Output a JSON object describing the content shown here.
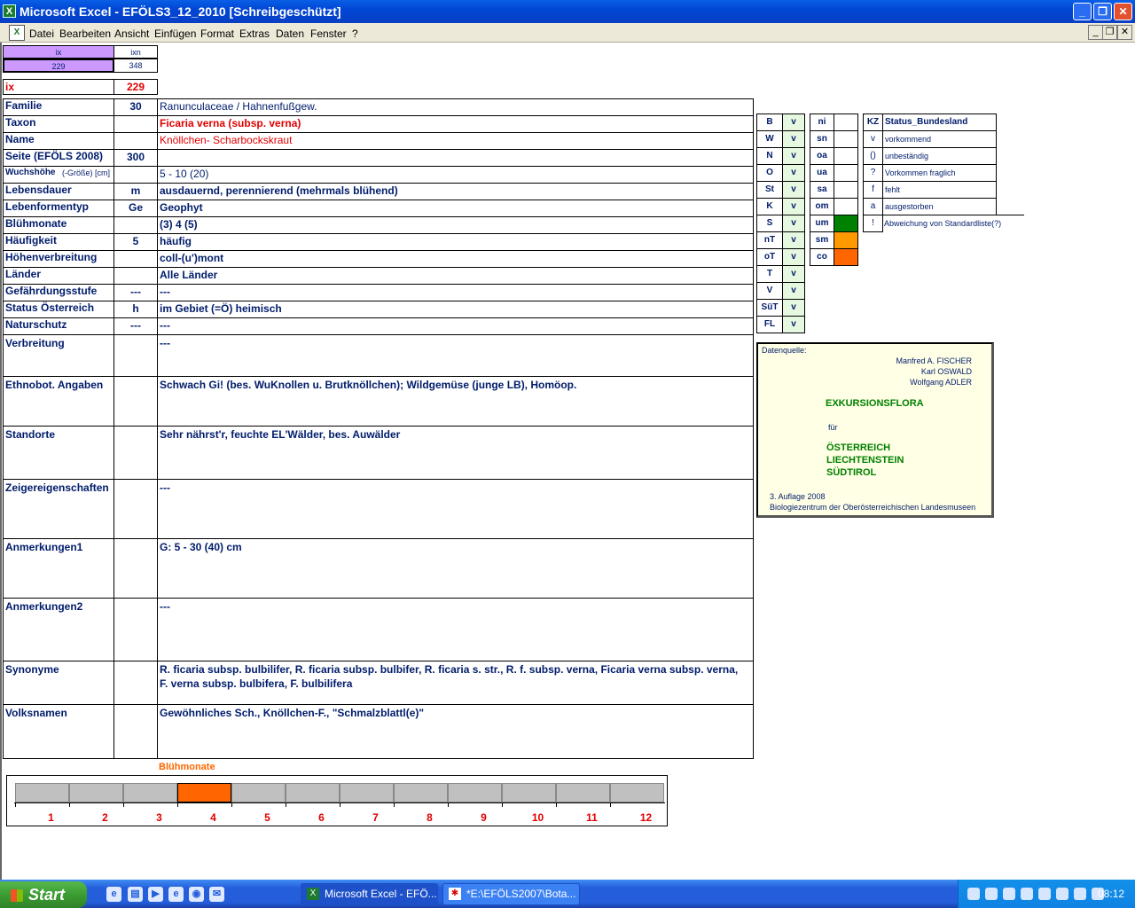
{
  "window": {
    "title": "Microsoft Excel - EFÖLS3_12_2010  [Schreibgeschützt]"
  },
  "menu": [
    "Datei",
    "Bearbeiten",
    "Ansicht",
    "Einfügen",
    "Format",
    "Extras",
    "Daten",
    "Fenster",
    "?"
  ],
  "top_cells": {
    "ix_label": "ix",
    "ixn_label": "ixn",
    "ix_value": "229",
    "ixn_value": "348",
    "ix_row_label": "ix",
    "ix_row_value": "229"
  },
  "fields": [
    {
      "label": "Familie",
      "mid": "30",
      "value": "Ranunculaceae  /  Hahnenfußgew."
    },
    {
      "label": "Taxon",
      "mid": "",
      "value": "Ficaria verna (subsp. verna)"
    },
    {
      "label": "Name",
      "mid": "",
      "value": "Knöllchen- Scharbockskraut"
    },
    {
      "label": "Seite (EFÖLS 2008)",
      "mid": "300",
      "value": ""
    },
    {
      "label": "Wuchshöhe",
      "label_extra": "(-Größe) [cm]",
      "mid": "",
      "value": " 5 - 10 (20)"
    },
    {
      "label": "Lebensdauer",
      "mid": "m",
      "value": "ausdauernd, perennierend (mehrmals blühend)"
    },
    {
      "label": "Lebenformentyp",
      "mid": "Ge",
      "value": "Geophyt"
    },
    {
      "label": "Blühmonate",
      "mid": "",
      "value": "(3) 4 (5)"
    },
    {
      "label": "Häufigkeit",
      "mid": "5",
      "value": "häufig"
    },
    {
      "label": "Höhenverbreitung",
      "mid": "",
      "value": "coll-(u')mont"
    },
    {
      "label": "Länder",
      "mid": "",
      "value": "Alle Länder"
    },
    {
      "label": "Gefährdungsstufe",
      "mid": "---",
      "value": "  ---"
    },
    {
      "label": "Status Österreich",
      "mid": "h",
      "value": "im Gebiet (=Ö) heimisch"
    },
    {
      "label": "Naturschutz",
      "mid": "---",
      "value": " ---"
    },
    {
      "label": "Verbreitung",
      "mid": "",
      "value": " ---"
    },
    {
      "label": "Ethnobot. Angaben",
      "mid": "",
      "value": "Schwach Gi! (bes. WuKnollen u. Brutknöllchen); Wildgemüse (junge LB), Homöop."
    },
    {
      "label": "Standorte",
      "mid": "",
      "value": "Sehr nährst'r, feuchte EL'Wälder, bes. Auwälder"
    },
    {
      "label": "Zeigereigenschaften",
      "mid": "",
      "value": "---"
    },
    {
      "label": "Anmerkungen1",
      "mid": "",
      "value": "G: 5 - 30 (40) cm"
    },
    {
      "label": "Anmerkungen2",
      "mid": "",
      "value": "---"
    },
    {
      "label": "Synonyme",
      "mid": "",
      "value": "R. ficaria subsp. bulbilifer, R. ficaria subsp. bulbifer, R. ficaria s. str., R. f. subsp. verna, Ficaria verna subsp. verna, F. verna subsp. bulbifera, F. bulbilifera"
    },
    {
      "label": "Volksnamen",
      "mid": "",
      "value": "Gewöhnliches Sch., Knöllchen-F., \"Schmalzblattl(e)\""
    }
  ],
  "regions": [
    {
      "code": "B",
      "val": "v"
    },
    {
      "code": "W",
      "val": "v"
    },
    {
      "code": "N",
      "val": "v"
    },
    {
      "code": "O",
      "val": "v"
    },
    {
      "code": "St",
      "val": "v"
    },
    {
      "code": "K",
      "val": "v"
    },
    {
      "code": "S",
      "val": "v"
    },
    {
      "code": "nT",
      "val": "v"
    },
    {
      "code": "oT",
      "val": "v"
    },
    {
      "code": "T",
      "val": "v"
    },
    {
      "code": "V",
      "val": "v"
    },
    {
      "code": "SüT",
      "val": "v"
    },
    {
      "code": "FL",
      "val": "v"
    }
  ],
  "status_codes": [
    {
      "code": "ni",
      "color": ""
    },
    {
      "code": "sn",
      "color": ""
    },
    {
      "code": "oa",
      "color": ""
    },
    {
      "code": "ua",
      "color": ""
    },
    {
      "code": "sa",
      "color": ""
    },
    {
      "code": "om",
      "color": ""
    },
    {
      "code": "um",
      "color": "#008000"
    },
    {
      "code": "sm",
      "color": "#ff9900"
    },
    {
      "code": "co",
      "color": "#ff6600"
    }
  ],
  "legend": {
    "kz_header": "KZ",
    "status_header": "Status_Bundesland",
    "rows": [
      {
        "kz": "v",
        "text": "vorkommend"
      },
      {
        "kz": "()",
        "text": "unbeständig"
      },
      {
        "kz": "?",
        "text": "Vorkommen fraglich"
      },
      {
        "kz": "f",
        "text": "fehlt"
      },
      {
        "kz": "a",
        "text": "ausgestorben"
      },
      {
        "kz": "!",
        "text": "Abweichung von Standardliste(?)"
      }
    ]
  },
  "source": {
    "label": "Datenquelle:",
    "authors": [
      "Manfred A. FISCHER",
      "Karl OSWALD",
      "Wolfgang ADLER"
    ],
    "title": "EXKURSIONSFLORA",
    "fuer": "für",
    "countries": [
      "ÖSTERREICH",
      "LIECHTENSTEIN",
      "SÜDTIROL"
    ],
    "edition": "3. Auflage 2008",
    "publisher": "Biologiezentrum der Oberösterreichischen Landesmuseen"
  },
  "chart_data": {
    "type": "bar",
    "title": "Blühmonate",
    "categories": [
      "1",
      "2",
      "3",
      "4",
      "5",
      "6",
      "7",
      "8",
      "9",
      "10",
      "11",
      "12"
    ],
    "values": [
      0,
      0,
      0,
      1,
      0,
      0,
      0,
      0,
      0,
      0,
      0,
      0
    ],
    "highlight_color": "#ff6600",
    "base_color": "#c0c0c0"
  },
  "taskbar": {
    "start_label": "Start",
    "buttons": [
      "Microsoft Excel - EFÖ...",
      "*E:\\EFÖLS2007\\Bota..."
    ],
    "clock": "08:12"
  }
}
